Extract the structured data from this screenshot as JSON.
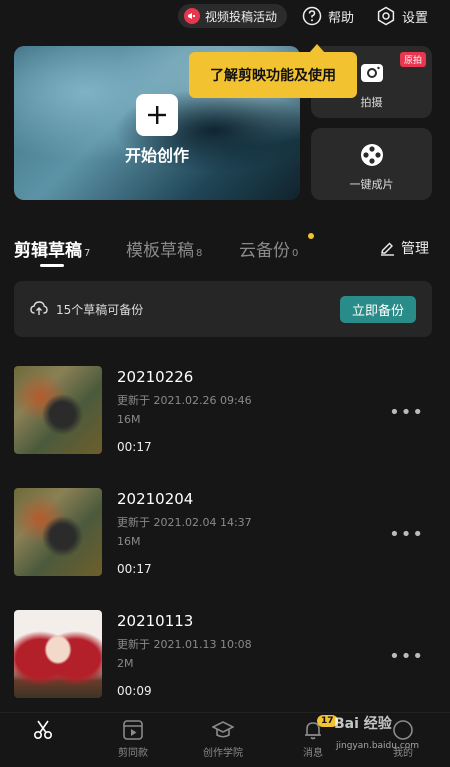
{
  "topbar": {
    "promo_label": "视频投稿活动",
    "help_label": "帮助",
    "settings_label": "设置"
  },
  "hero": {
    "label": "开始创作"
  },
  "side_cards": {
    "shoot_label": "拍摄",
    "shoot_badge": "原拍",
    "onekey_label": "一键成片"
  },
  "tooltip": {
    "text": "了解剪映功能及使用"
  },
  "tabs": [
    {
      "label": "剪辑草稿",
      "count": "7"
    },
    {
      "label": "模板草稿",
      "count": "8"
    },
    {
      "label": "云备份",
      "count": "0"
    }
  ],
  "manage_label": "管理",
  "backup": {
    "text": "15个草稿可备份",
    "button": "立即备份"
  },
  "drafts": [
    {
      "title": "20210226",
      "updated": "更新于 2021.02.26 09:46",
      "size": "16M",
      "duration": "00:17"
    },
    {
      "title": "20210204",
      "updated": "更新于 2021.02.04 14:37",
      "size": "16M",
      "duration": "00:17"
    },
    {
      "title": "20210113",
      "updated": "更新于 2021.01.13 10:08",
      "size": "2M",
      "duration": "00:09"
    }
  ],
  "bottomnav": {
    "items": [
      {
        "label": ""
      },
      {
        "label": "剪同款"
      },
      {
        "label": "创作学院"
      },
      {
        "label": "消息",
        "badge": "17"
      },
      {
        "label": "我的"
      }
    ]
  },
  "watermark": {
    "text": "Bai 经验",
    "sub": "jingyan.baidu.com"
  },
  "colors": {
    "background": "#161616",
    "accent_yellow": "#f2c230",
    "accent_teal": "#2a8c88",
    "accent_red": "#e8364f"
  }
}
